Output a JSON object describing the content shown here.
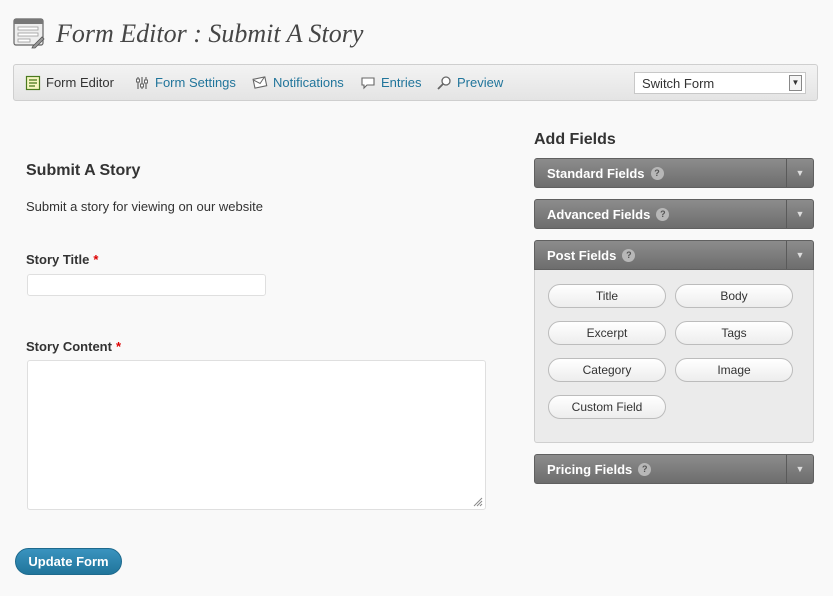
{
  "page": {
    "title": "Form Editor : Submit A Story"
  },
  "toolbar": {
    "items": [
      {
        "label": "Form Editor",
        "icon": "form-editor-icon"
      },
      {
        "label": "Form Settings",
        "icon": "form-settings-icon"
      },
      {
        "label": "Notifications",
        "icon": "notifications-icon"
      },
      {
        "label": "Entries",
        "icon": "entries-icon"
      },
      {
        "label": "Preview",
        "icon": "preview-icon"
      }
    ],
    "switch_form": "Switch Form"
  },
  "form": {
    "title": "Submit A Story",
    "description": "Submit a story for viewing on our website",
    "fields": [
      {
        "label": "Story Title",
        "required": "*"
      },
      {
        "label": "Story Content",
        "required": "*"
      }
    ],
    "update_button": "Update Form"
  },
  "add_fields": {
    "title": "Add Fields",
    "help": "?",
    "panels": [
      {
        "label": "Standard Fields"
      },
      {
        "label": "Advanced Fields"
      },
      {
        "label": "Post Fields",
        "buttons": [
          "Title",
          "Body",
          "Excerpt",
          "Tags",
          "Category",
          "Image",
          "Custom Field"
        ]
      },
      {
        "label": "Pricing Fields"
      }
    ]
  },
  "colors": {
    "link": "#21759b",
    "required": "#dd0000",
    "panel_header": "#7a7a7a"
  }
}
